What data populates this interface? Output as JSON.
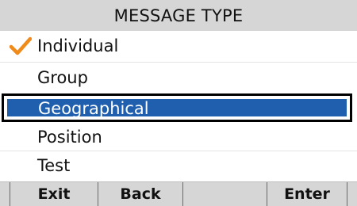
{
  "header": {
    "title": "MESSAGE TYPE"
  },
  "menu": {
    "items": [
      {
        "label": "Individual",
        "checked": true
      },
      {
        "label": "Group"
      },
      {
        "label": "Geographical",
        "highlighted": true
      },
      {
        "label": "Position"
      },
      {
        "label": "Test"
      }
    ]
  },
  "softkeys": {
    "exit": "Exit",
    "back": "Back",
    "empty": "",
    "enter": "Enter"
  },
  "colors": {
    "highlight": "#1f5fae",
    "check": "#f08a1a",
    "bar": "#d6d6d6"
  },
  "icons": {
    "check": "checkmark-icon"
  }
}
